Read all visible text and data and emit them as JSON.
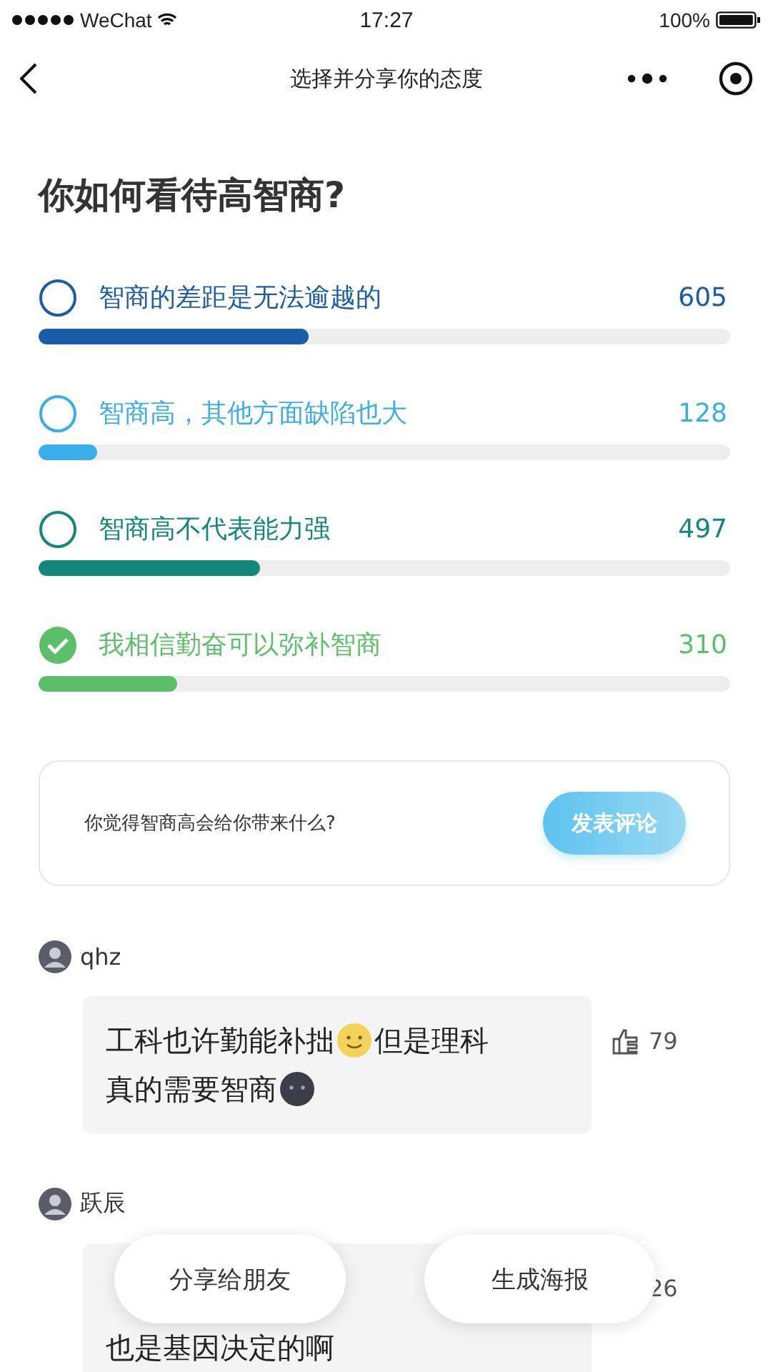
{
  "status_bar": {
    "carrier": "WeChat",
    "time": "17:27",
    "battery": "100%"
  },
  "nav": {
    "title": "选择并分享你的态度"
  },
  "question": "你如何看待高智商?",
  "options": [
    {
      "label": "智商的差距是无法逾越的",
      "count": "605",
      "level": 0.39,
      "color": "#1b5ca6",
      "selected": false
    },
    {
      "label": "智商高，其他方面缺陷也大",
      "count": "128",
      "level": 0.085,
      "color": "#3aaee8",
      "selected": false
    },
    {
      "label": "智商高不代表能力强",
      "count": "497",
      "level": 0.32,
      "color": "#13877a",
      "selected": false
    },
    {
      "label": "我相信勤奋可以弥补智商",
      "count": "310",
      "level": 0.2,
      "color": "#5cbf6a",
      "selected": true
    }
  ],
  "comment_prompt": {
    "text": "你觉得智商高会给你带来什么?",
    "button": "发表评论"
  },
  "comments": [
    {
      "user": "qhz",
      "likes": "79",
      "lines": [
        [
          {
            "kind": "text",
            "text": "工科也许勤能补拙"
          },
          {
            "kind": "smile"
          },
          {
            "kind": "text",
            "text": "但是理科"
          }
        ],
        [
          {
            "kind": "text",
            "text": "真的需要智商"
          },
          {
            "kind": "moon"
          }
        ]
      ]
    },
    {
      "user": "跃辰",
      "likes": "26",
      "lines": [
        [
          {
            "kind": "text",
            "text": "也是基因决定的啊"
          }
        ]
      ]
    }
  ],
  "actions": [
    "分享给朋友",
    "生成海报"
  ]
}
